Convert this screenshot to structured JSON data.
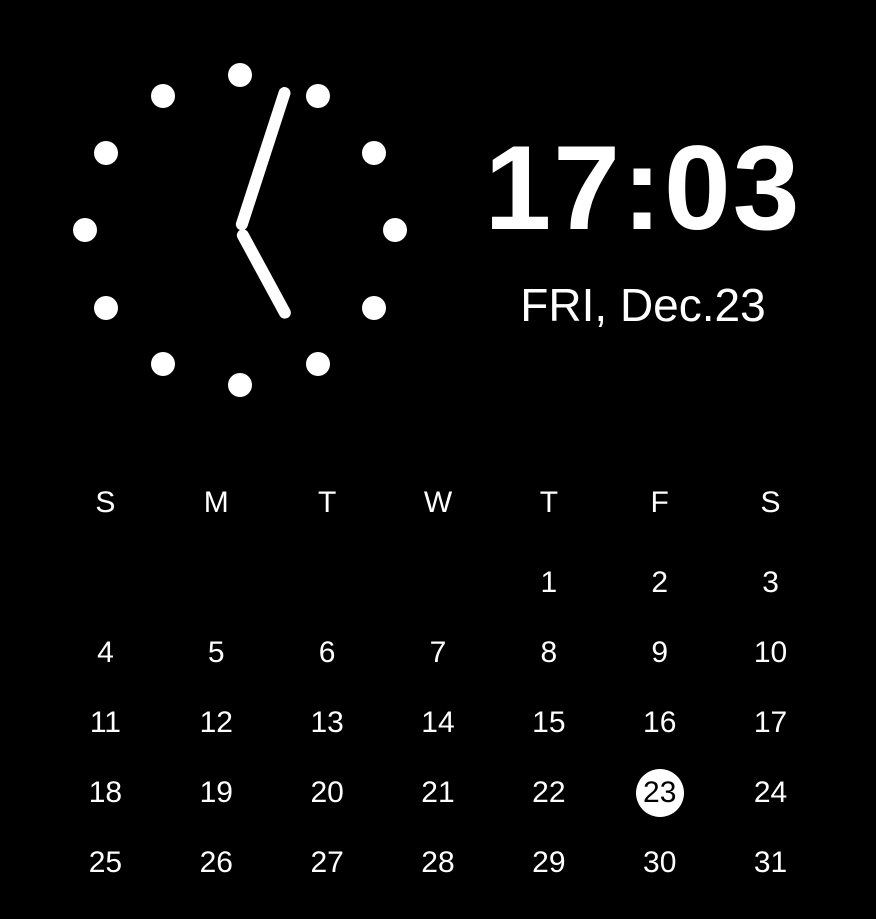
{
  "clock": {
    "digital_time": "17:03",
    "date_line": "FRI, Dec.23",
    "hour_hand_angle_deg": 151.5,
    "minute_hand_angle_deg": 18
  },
  "calendar": {
    "weekday_labels": [
      "S",
      "M",
      "T",
      "W",
      "T",
      "F",
      "S"
    ],
    "today": 23,
    "weeks": [
      [
        "",
        "",
        "",
        "",
        "1",
        "2",
        "3"
      ],
      [
        "4",
        "5",
        "6",
        "7",
        "8",
        "9",
        "10"
      ],
      [
        "11",
        "12",
        "13",
        "14",
        "15",
        "16",
        "17"
      ],
      [
        "18",
        "19",
        "20",
        "21",
        "22",
        "23",
        "24"
      ],
      [
        "25",
        "26",
        "27",
        "28",
        "29",
        "30",
        "31"
      ]
    ]
  },
  "colors": {
    "background": "#000000",
    "foreground": "#ffffff"
  }
}
